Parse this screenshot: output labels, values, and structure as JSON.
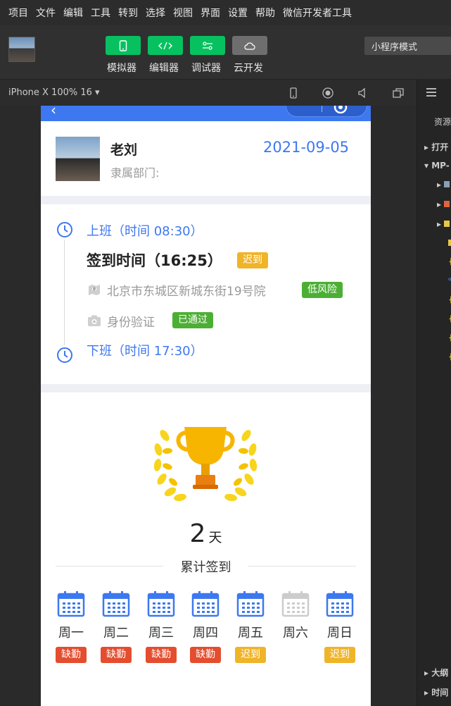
{
  "menu": [
    "项目",
    "文件",
    "编辑",
    "工具",
    "转到",
    "选择",
    "视图",
    "界面",
    "设置",
    "帮助",
    "微信开发者工具"
  ],
  "toolbar": {
    "buttons": [
      {
        "label": "模拟器",
        "icon": "phone-icon"
      },
      {
        "label": "编辑器",
        "icon": "code-icon"
      },
      {
        "label": "调试器",
        "icon": "debug-icon"
      },
      {
        "label": "云开发",
        "icon": "cloud-icon"
      }
    ],
    "mode": "小程序模式"
  },
  "device": {
    "label": "iPhone X 100% 16 ▾"
  },
  "right_panel": {
    "resources": "资源",
    "open": "打开",
    "project": "MP-",
    "outline": "大纲",
    "timeline": "时间"
  },
  "profile": {
    "name": "老刘",
    "dept": "隶属部门:",
    "date": "2021-09-05"
  },
  "shift_in": {
    "label": "上班（时间 08:30）"
  },
  "sign": {
    "time": "签到时间（16:25）",
    "status": "迟到"
  },
  "location": {
    "address": "北京市东城区新城东街19号院",
    "risk": "低风险"
  },
  "identity": {
    "label": "身份验证",
    "status": "已通过"
  },
  "shift_out": {
    "label": "下班（时间 17:30）"
  },
  "stats": {
    "days": "2",
    "unit": "天",
    "total_label": "累计签到"
  },
  "week": [
    {
      "label": "周一",
      "status": "缺勤",
      "color": "#e44d2e",
      "active": true
    },
    {
      "label": "周二",
      "status": "缺勤",
      "color": "#e44d2e",
      "active": true
    },
    {
      "label": "周三",
      "status": "缺勤",
      "color": "#e44d2e",
      "active": true
    },
    {
      "label": "周四",
      "status": "缺勤",
      "color": "#e44d2e",
      "active": true
    },
    {
      "label": "周五",
      "status": "迟到",
      "color": "#f0b429",
      "active": true
    },
    {
      "label": "周六",
      "status": "",
      "color": "",
      "active": false
    },
    {
      "label": "周日",
      "status": "迟到",
      "color": "#f0b429",
      "active": true
    }
  ],
  "colors": {
    "accent": "#3d78f0",
    "toolbar_green": "#07c160",
    "late": "#f0b429",
    "absent": "#e44d2e",
    "ok": "#4caf34"
  }
}
